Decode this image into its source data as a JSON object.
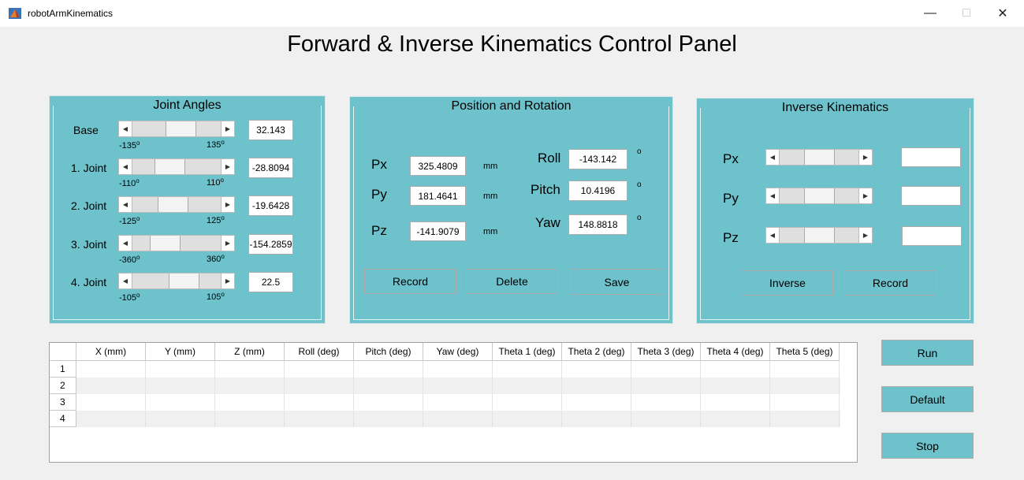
{
  "window": {
    "title": "robotArmKinematics",
    "minimize": "—",
    "maximize": "□",
    "close": "✕"
  },
  "main_title": "Forward & Inverse Kinematics Control Panel",
  "joint_panel": {
    "title": "Joint Angles",
    "degree_symbol": "o",
    "joints": [
      {
        "label": "Base",
        "min": "-135",
        "max": "135",
        "value": "32.143",
        "slider_fraction": 0.56
      },
      {
        "label": "1. Joint",
        "min": "-110",
        "max": "110",
        "value": "-28.8094",
        "slider_fraction": 0.37
      },
      {
        "label": "2. Joint",
        "min": "-125",
        "max": "125",
        "value": "-19.6428",
        "slider_fraction": 0.42
      },
      {
        "label": "3. Joint",
        "min": "-360",
        "max": "360",
        "value": "-154.2859",
        "slider_fraction": 0.29
      },
      {
        "label": "4. Joint",
        "min": "-105",
        "max": "105",
        "value": "22.5",
        "slider_fraction": 0.61
      }
    ]
  },
  "position_panel": {
    "title": "Position and Rotation",
    "px_label": "Px",
    "px_value": "325.4809",
    "px_unit": "mm",
    "py_label": "Py",
    "py_value": "181.4641",
    "py_unit": "mm",
    "pz_label": "Pz",
    "pz_value": "-141.9079",
    "pz_unit": "mm",
    "roll_label": "Roll",
    "roll_value": "-143.142",
    "roll_unit": "o",
    "pitch_label": "Pitch",
    "pitch_value": "10.4196",
    "pitch_unit": "o",
    "yaw_label": "Yaw",
    "yaw_value": "148.8818",
    "yaw_unit": "o",
    "record_label": "Record",
    "delete_label": "Delete",
    "save_label": "Save"
  },
  "inverse_panel": {
    "title": "Inverse Kinematics",
    "px_label": "Px",
    "px_value": "",
    "py_label": "Py",
    "py_value": "",
    "pz_label": "Pz",
    "pz_value": "",
    "inverse_label": "Inverse",
    "record_label": "Record"
  },
  "table": {
    "columns": [
      "X (mm)",
      "Y (mm)",
      "Z (mm)",
      "Roll (deg)",
      "Pitch (deg)",
      "Yaw (deg)",
      "Theta 1 (deg)",
      "Theta 2 (deg)",
      "Theta 3 (deg)",
      "Theta 4 (deg)",
      "Theta 5 (deg)"
    ],
    "rows": [
      "1",
      "2",
      "3",
      "4"
    ]
  },
  "side_buttons": {
    "run_label": "Run",
    "default_label": "Default",
    "stop_label": "Stop"
  },
  "colors": {
    "panel": "#6ec2cc",
    "background": "#f0f0f0"
  }
}
